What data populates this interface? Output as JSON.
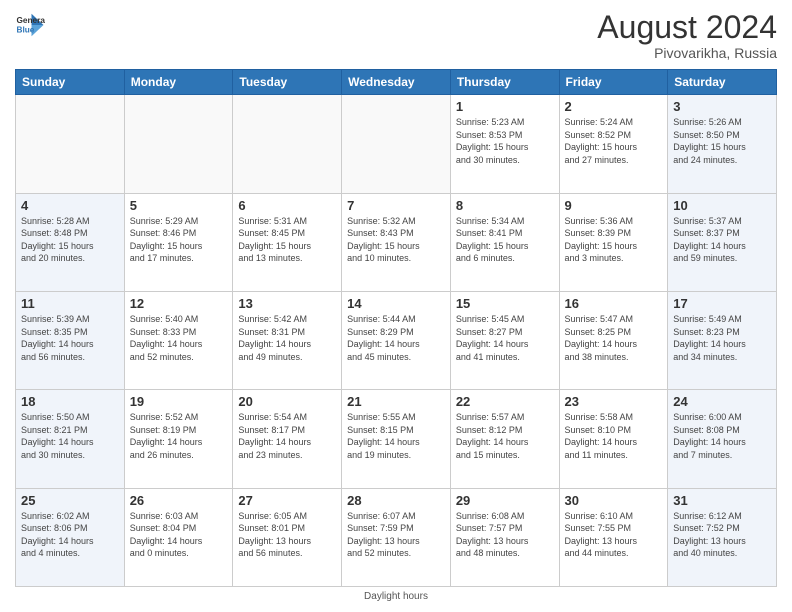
{
  "header": {
    "logo_line1": "General",
    "logo_line2": "Blue",
    "month_year": "August 2024",
    "location": "Pivovarikha, Russia"
  },
  "footer": {
    "note": "Daylight hours"
  },
  "days_of_week": [
    "Sunday",
    "Monday",
    "Tuesday",
    "Wednesday",
    "Thursday",
    "Friday",
    "Saturday"
  ],
  "weeks": [
    [
      {
        "num": "",
        "detail": "",
        "type": "empty"
      },
      {
        "num": "",
        "detail": "",
        "type": "empty"
      },
      {
        "num": "",
        "detail": "",
        "type": "empty"
      },
      {
        "num": "",
        "detail": "",
        "type": "empty"
      },
      {
        "num": "1",
        "detail": "Sunrise: 5:23 AM\nSunset: 8:53 PM\nDaylight: 15 hours\nand 30 minutes.",
        "type": "weekday"
      },
      {
        "num": "2",
        "detail": "Sunrise: 5:24 AM\nSunset: 8:52 PM\nDaylight: 15 hours\nand 27 minutes.",
        "type": "weekday"
      },
      {
        "num": "3",
        "detail": "Sunrise: 5:26 AM\nSunset: 8:50 PM\nDaylight: 15 hours\nand 24 minutes.",
        "type": "weekend"
      }
    ],
    [
      {
        "num": "4",
        "detail": "Sunrise: 5:28 AM\nSunset: 8:48 PM\nDaylight: 15 hours\nand 20 minutes.",
        "type": "weekend"
      },
      {
        "num": "5",
        "detail": "Sunrise: 5:29 AM\nSunset: 8:46 PM\nDaylight: 15 hours\nand 17 minutes.",
        "type": "weekday"
      },
      {
        "num": "6",
        "detail": "Sunrise: 5:31 AM\nSunset: 8:45 PM\nDaylight: 15 hours\nand 13 minutes.",
        "type": "weekday"
      },
      {
        "num": "7",
        "detail": "Sunrise: 5:32 AM\nSunset: 8:43 PM\nDaylight: 15 hours\nand 10 minutes.",
        "type": "weekday"
      },
      {
        "num": "8",
        "detail": "Sunrise: 5:34 AM\nSunset: 8:41 PM\nDaylight: 15 hours\nand 6 minutes.",
        "type": "weekday"
      },
      {
        "num": "9",
        "detail": "Sunrise: 5:36 AM\nSunset: 8:39 PM\nDaylight: 15 hours\nand 3 minutes.",
        "type": "weekday"
      },
      {
        "num": "10",
        "detail": "Sunrise: 5:37 AM\nSunset: 8:37 PM\nDaylight: 14 hours\nand 59 minutes.",
        "type": "weekend"
      }
    ],
    [
      {
        "num": "11",
        "detail": "Sunrise: 5:39 AM\nSunset: 8:35 PM\nDaylight: 14 hours\nand 56 minutes.",
        "type": "weekend"
      },
      {
        "num": "12",
        "detail": "Sunrise: 5:40 AM\nSunset: 8:33 PM\nDaylight: 14 hours\nand 52 minutes.",
        "type": "weekday"
      },
      {
        "num": "13",
        "detail": "Sunrise: 5:42 AM\nSunset: 8:31 PM\nDaylight: 14 hours\nand 49 minutes.",
        "type": "weekday"
      },
      {
        "num": "14",
        "detail": "Sunrise: 5:44 AM\nSunset: 8:29 PM\nDaylight: 14 hours\nand 45 minutes.",
        "type": "weekday"
      },
      {
        "num": "15",
        "detail": "Sunrise: 5:45 AM\nSunset: 8:27 PM\nDaylight: 14 hours\nand 41 minutes.",
        "type": "weekday"
      },
      {
        "num": "16",
        "detail": "Sunrise: 5:47 AM\nSunset: 8:25 PM\nDaylight: 14 hours\nand 38 minutes.",
        "type": "weekday"
      },
      {
        "num": "17",
        "detail": "Sunrise: 5:49 AM\nSunset: 8:23 PM\nDaylight: 14 hours\nand 34 minutes.",
        "type": "weekend"
      }
    ],
    [
      {
        "num": "18",
        "detail": "Sunrise: 5:50 AM\nSunset: 8:21 PM\nDaylight: 14 hours\nand 30 minutes.",
        "type": "weekend"
      },
      {
        "num": "19",
        "detail": "Sunrise: 5:52 AM\nSunset: 8:19 PM\nDaylight: 14 hours\nand 26 minutes.",
        "type": "weekday"
      },
      {
        "num": "20",
        "detail": "Sunrise: 5:54 AM\nSunset: 8:17 PM\nDaylight: 14 hours\nand 23 minutes.",
        "type": "weekday"
      },
      {
        "num": "21",
        "detail": "Sunrise: 5:55 AM\nSunset: 8:15 PM\nDaylight: 14 hours\nand 19 minutes.",
        "type": "weekday"
      },
      {
        "num": "22",
        "detail": "Sunrise: 5:57 AM\nSunset: 8:12 PM\nDaylight: 14 hours\nand 15 minutes.",
        "type": "weekday"
      },
      {
        "num": "23",
        "detail": "Sunrise: 5:58 AM\nSunset: 8:10 PM\nDaylight: 14 hours\nand 11 minutes.",
        "type": "weekday"
      },
      {
        "num": "24",
        "detail": "Sunrise: 6:00 AM\nSunset: 8:08 PM\nDaylight: 14 hours\nand 7 minutes.",
        "type": "weekend"
      }
    ],
    [
      {
        "num": "25",
        "detail": "Sunrise: 6:02 AM\nSunset: 8:06 PM\nDaylight: 14 hours\nand 4 minutes.",
        "type": "weekend"
      },
      {
        "num": "26",
        "detail": "Sunrise: 6:03 AM\nSunset: 8:04 PM\nDaylight: 14 hours\nand 0 minutes.",
        "type": "weekday"
      },
      {
        "num": "27",
        "detail": "Sunrise: 6:05 AM\nSunset: 8:01 PM\nDaylight: 13 hours\nand 56 minutes.",
        "type": "weekday"
      },
      {
        "num": "28",
        "detail": "Sunrise: 6:07 AM\nSunset: 7:59 PM\nDaylight: 13 hours\nand 52 minutes.",
        "type": "weekday"
      },
      {
        "num": "29",
        "detail": "Sunrise: 6:08 AM\nSunset: 7:57 PM\nDaylight: 13 hours\nand 48 minutes.",
        "type": "weekday"
      },
      {
        "num": "30",
        "detail": "Sunrise: 6:10 AM\nSunset: 7:55 PM\nDaylight: 13 hours\nand 44 minutes.",
        "type": "weekday"
      },
      {
        "num": "31",
        "detail": "Sunrise: 6:12 AM\nSunset: 7:52 PM\nDaylight: 13 hours\nand 40 minutes.",
        "type": "weekend"
      }
    ]
  ]
}
